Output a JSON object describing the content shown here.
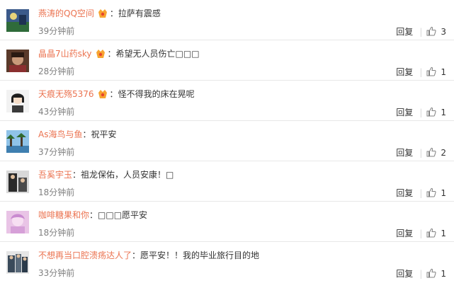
{
  "accent_color": "#eb7350",
  "comments": [
    {
      "username": "燕涛的QQ空间",
      "badge": true,
      "separator": "：",
      "text": "拉萨有震感",
      "time": "39分钟前",
      "reply_label": "回复",
      "likes": "3"
    },
    {
      "username": "晶晶7山药sky",
      "badge": true,
      "separator": "：",
      "text": "希望无人员伤亡□□□",
      "time": "28分钟前",
      "reply_label": "回复",
      "likes": "1"
    },
    {
      "username": "天痕无殇5376",
      "badge": true,
      "separator": "：",
      "text": "怪不得我的床在晃呢",
      "time": "43分钟前",
      "reply_label": "回复",
      "likes": "1"
    },
    {
      "username": "As海鸟与鱼",
      "badge": false,
      "separator": "：",
      "text": "祝平安",
      "time": "37分钟前",
      "reply_label": "回复",
      "likes": "2"
    },
    {
      "username": "吾奚宇玉",
      "badge": false,
      "separator": "：",
      "text": "祖龙保佑，人员安康！□",
      "time": "18分钟前",
      "reply_label": "回复",
      "likes": "1"
    },
    {
      "username": "咖啡糖果和你",
      "badge": false,
      "separator": "：",
      "text": "□□□愿平安",
      "time": "18分钟前",
      "reply_label": "回复",
      "likes": "1"
    },
    {
      "username": "不想再当口腔溃疡达人了",
      "badge": false,
      "separator": "：",
      "text": "愿平安！！我的毕业旅行目的地",
      "time": "33分钟前",
      "reply_label": "回复",
      "likes": "1"
    }
  ]
}
